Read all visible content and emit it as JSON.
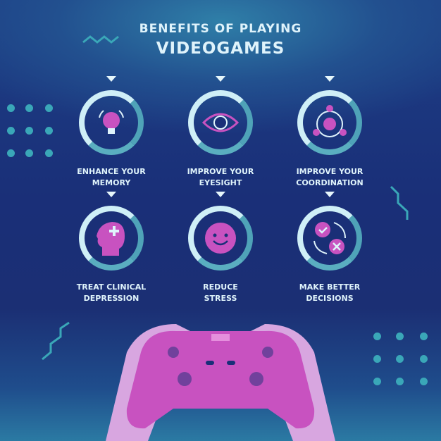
{
  "title": {
    "line1": "Benefits of playing",
    "line2": "Videogames"
  },
  "benefits": [
    {
      "label1": "Enhance Your",
      "label2": "Memory",
      "icon": "lightbulb-icon"
    },
    {
      "label1": "Improve your",
      "label2": "Eyesight",
      "icon": "eye-icon"
    },
    {
      "label1": "Improve your",
      "label2": "Coordination",
      "icon": "coordination-icon"
    },
    {
      "label1": "Treat clinical",
      "label2": "depression",
      "icon": "head-plus-icon"
    },
    {
      "label1": "Reduce",
      "label2": "Stress",
      "icon": "smiley-icon"
    },
    {
      "label1": "Make better",
      "label2": "decisions",
      "icon": "check-cross-icon"
    }
  ],
  "colors": {
    "accent": "#c852c0",
    "ring": "#cfeff7",
    "text": "#dff3fb",
    "bg": "#1a2f78"
  }
}
